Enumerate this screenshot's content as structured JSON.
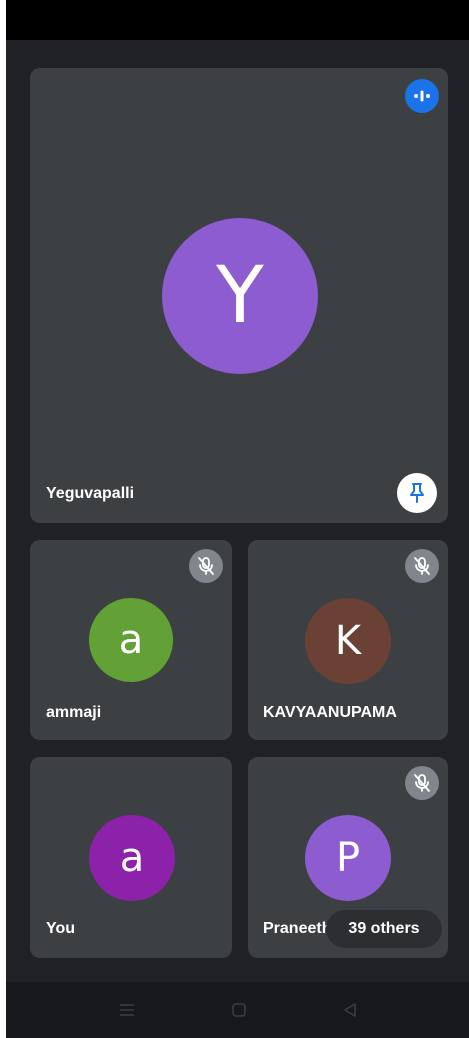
{
  "colors": {
    "background": "#202124",
    "tile": "#3c4043",
    "speaking_indicator": "#1a73e8",
    "mute_badge": "#80868b",
    "pin_icon": "#1a73e8"
  },
  "main_tile": {
    "name": "Yeguvapalli",
    "avatar_letter": "Y",
    "avatar_color": "#8e5cd1",
    "speaking_icon": "speaking-indicator-icon",
    "pin_icon": "pin-icon"
  },
  "tiles": [
    {
      "name": "ammaji",
      "avatar_letter": "a",
      "avatar_color": "#61a135",
      "muted": true
    },
    {
      "name": "KAVYAANUPAMA",
      "avatar_letter": "K",
      "avatar_color": "#6a4134",
      "muted": true
    },
    {
      "name": "You",
      "avatar_letter": "a",
      "avatar_color": "#8c21aa",
      "muted": false
    },
    {
      "name": "Praneeth",
      "avatar_letter": "P",
      "avatar_color": "#8e5cd1",
      "muted": true
    }
  ],
  "others_chip": {
    "label": "39 others"
  },
  "nav": {
    "menu_icon": "menu-icon",
    "home_icon": "home-square-icon",
    "back_icon": "back-triangle-icon"
  }
}
